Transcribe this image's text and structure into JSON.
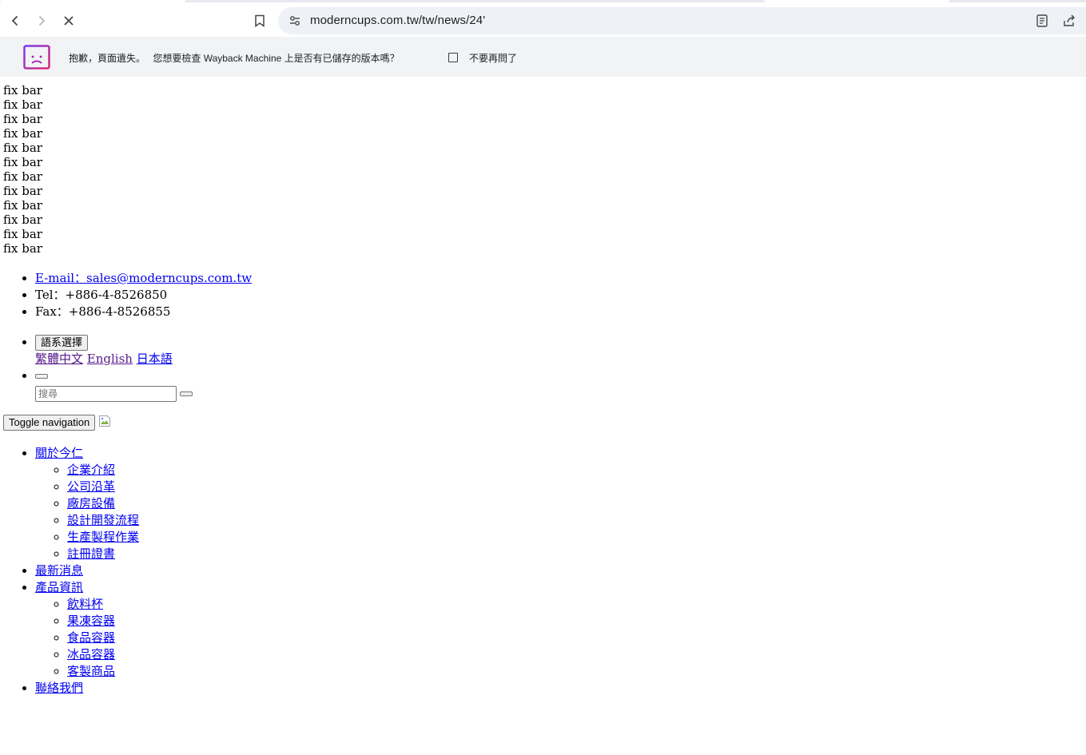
{
  "browser": {
    "url": "moderncups.com.tw/tw/news/24'",
    "back_icon": "arrow-left-icon",
    "forward_icon": "arrow-right-icon",
    "stop_icon": "close-icon",
    "bookmark_icon": "bookmark-icon",
    "site_info_icon": "tune-icon",
    "reader_icon": "reading-mode-icon",
    "share_icon": "share-icon"
  },
  "infobar": {
    "message": "抱歉，頁面遺失。",
    "question": "您想要檢查 Wayback Machine 上是否有已儲存的版本嗎？",
    "checkbox_label": "不要再問了",
    "logo_color": "#c026d3"
  },
  "page": {
    "fixbars": [
      "fix bar",
      "fix bar",
      "fix bar",
      "fix bar",
      "fix bar",
      "fix bar",
      "fix bar",
      "fix bar",
      "fix bar",
      "fix bar",
      "fix bar",
      "fix bar"
    ],
    "contact": {
      "email": "E-mail：sales@moderncups.com.tw",
      "tel": "Tel：+886-4-8526850",
      "fax": "Fax：+886-4-8526855"
    },
    "language": {
      "button": "語系選擇",
      "options": [
        "繁體中文",
        "English",
        "日本語"
      ]
    },
    "search": {
      "placeholder": "搜尋"
    },
    "toggle_nav": "Toggle navigation",
    "menu": {
      "about": "關於今仁",
      "about_items": [
        "企業介紹",
        "公司沿革",
        "廠房設備",
        "設計開發流程",
        "生產製程作業",
        "註冊證書"
      ],
      "news": "最新消息",
      "products": "產品資訊",
      "product_items": [
        "飲料杯",
        "果凍容器",
        "食品容器",
        "冰品容器",
        "客製商品"
      ],
      "contact": "聯絡我們"
    }
  }
}
